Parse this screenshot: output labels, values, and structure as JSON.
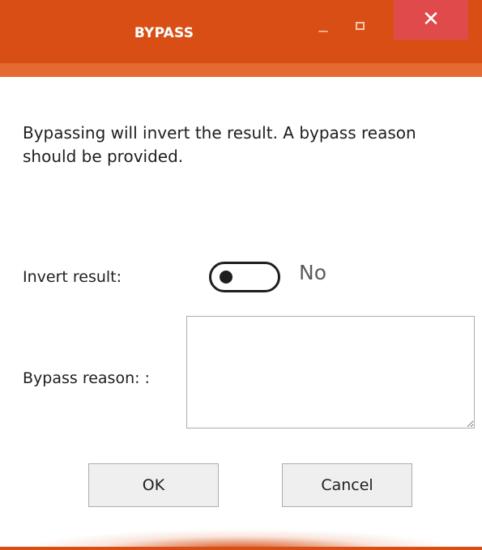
{
  "window": {
    "title": "BYPASS",
    "controls": {
      "minimize": "_",
      "close": "✕"
    },
    "accent_color": "#d84e14",
    "close_color": "#e14a4a"
  },
  "content": {
    "description": "Bypassing will invert the result. A bypass reason should be provided.",
    "invert_label": "Invert result:",
    "invert_state": "No",
    "invert_on": false,
    "reason_label": "Bypass reason: :",
    "reason_value": ""
  },
  "buttons": {
    "ok": "OK",
    "cancel": "Cancel"
  }
}
